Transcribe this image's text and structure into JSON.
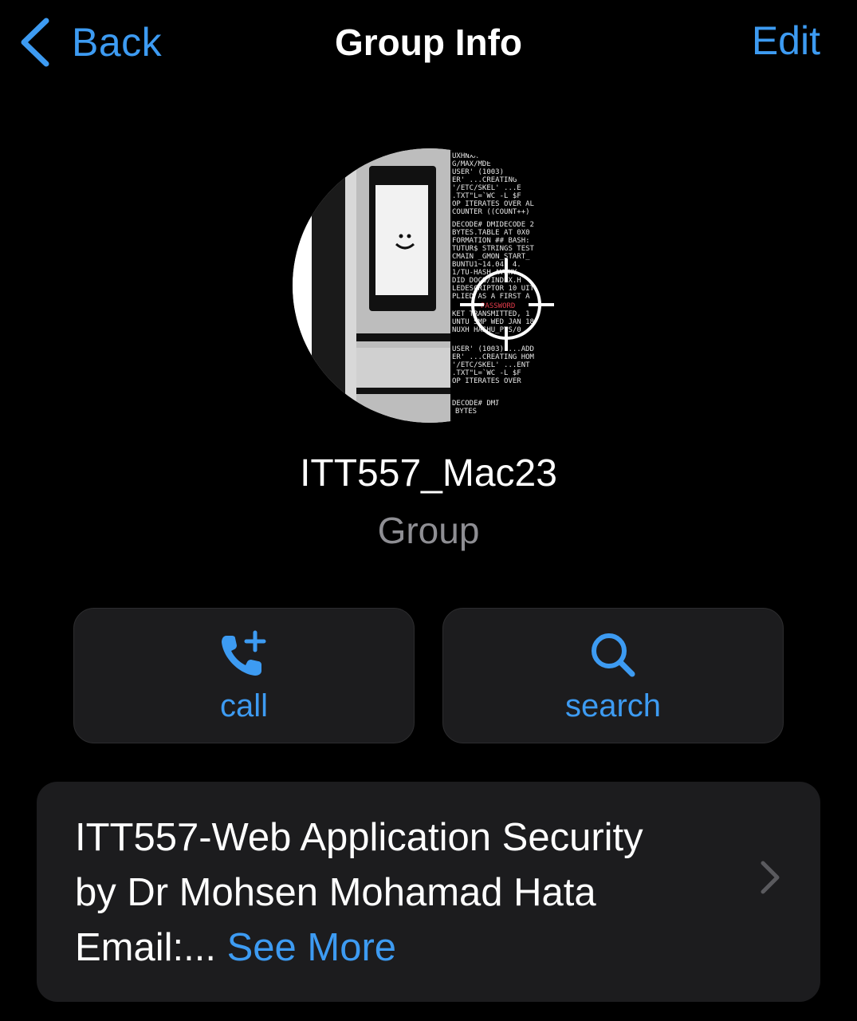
{
  "nav": {
    "back_label": "Back",
    "title": "Group Info",
    "edit_label": "Edit"
  },
  "profile": {
    "name": "ITT557_Mac23",
    "subtitle": "Group"
  },
  "actions": [
    {
      "label": "call",
      "icon": "phone-plus-icon"
    },
    {
      "label": "search",
      "icon": "search-icon"
    }
  ],
  "description": {
    "line1": "ITT557-Web Application Security",
    "line2": "by Dr Mohsen Mohamad Hata",
    "line3": "Email:...",
    "see_more": "See More"
  },
  "colors": {
    "accent": "#3d9bf2",
    "background": "#000000",
    "card": "#1c1c1e",
    "secondary_text": "#8e8e93"
  }
}
